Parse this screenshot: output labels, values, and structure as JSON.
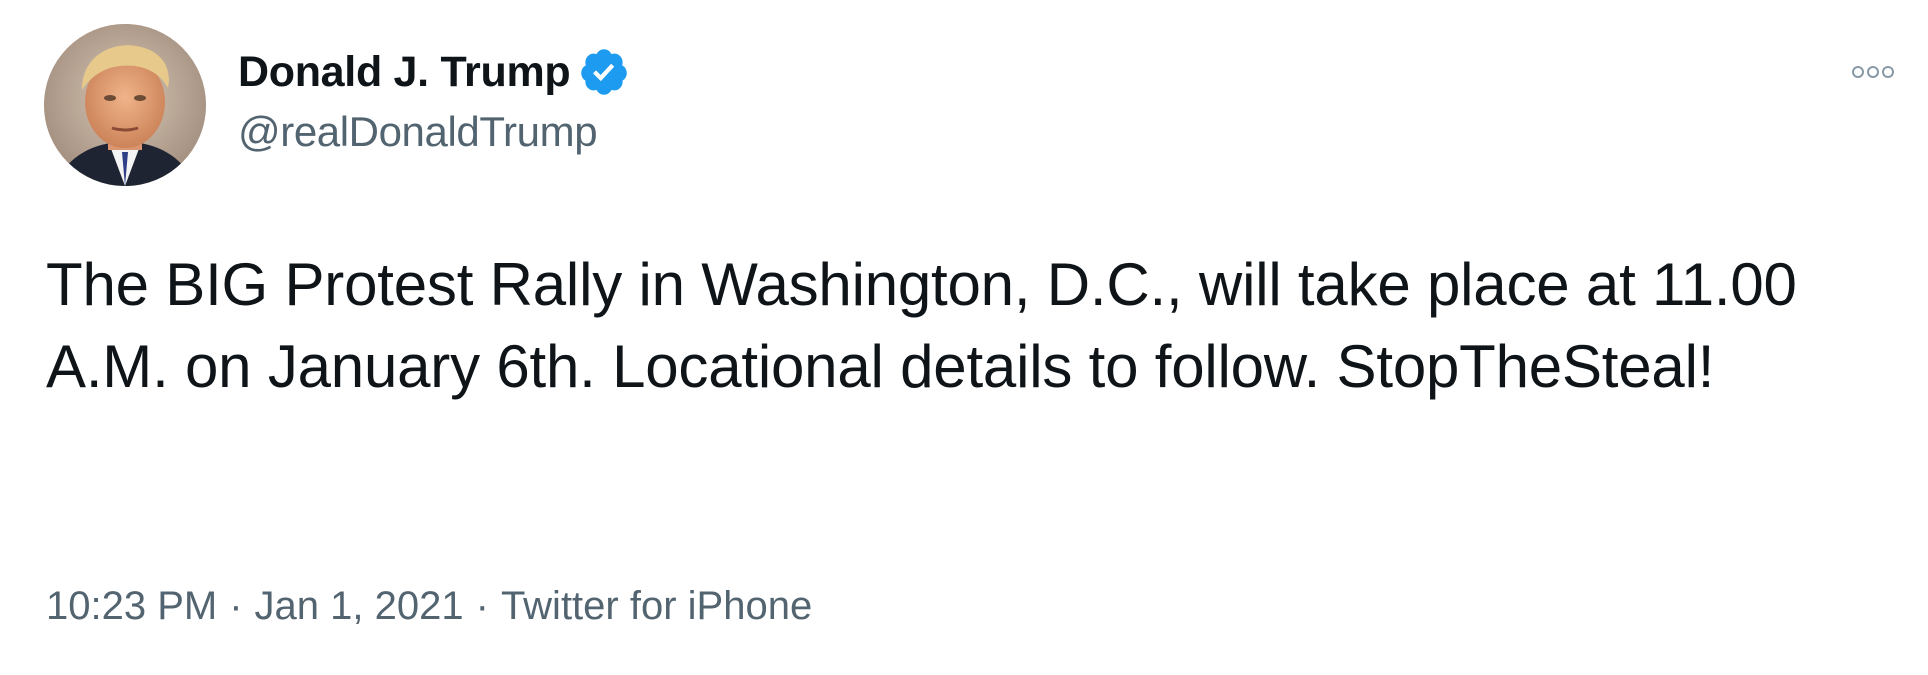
{
  "tweet": {
    "author": {
      "display_name": "Donald J. Trump",
      "handle": "@realDonaldTrump",
      "verified": true,
      "verified_icon": "verified-badge-icon",
      "verified_color": "#1d9bf0"
    },
    "text": "The BIG Protest Rally in Washington, D.C., will take place at 11.00 A.M. on January 6th. Locational details to follow. StopTheSteal!",
    "time": "10:23 PM",
    "date": "Jan 1, 2021",
    "source": "Twitter for iPhone",
    "separator": "·",
    "more_icon": "more-options-icon"
  },
  "colors": {
    "text_primary": "#0f1419",
    "text_secondary": "#536471",
    "background": "#ffffff"
  }
}
